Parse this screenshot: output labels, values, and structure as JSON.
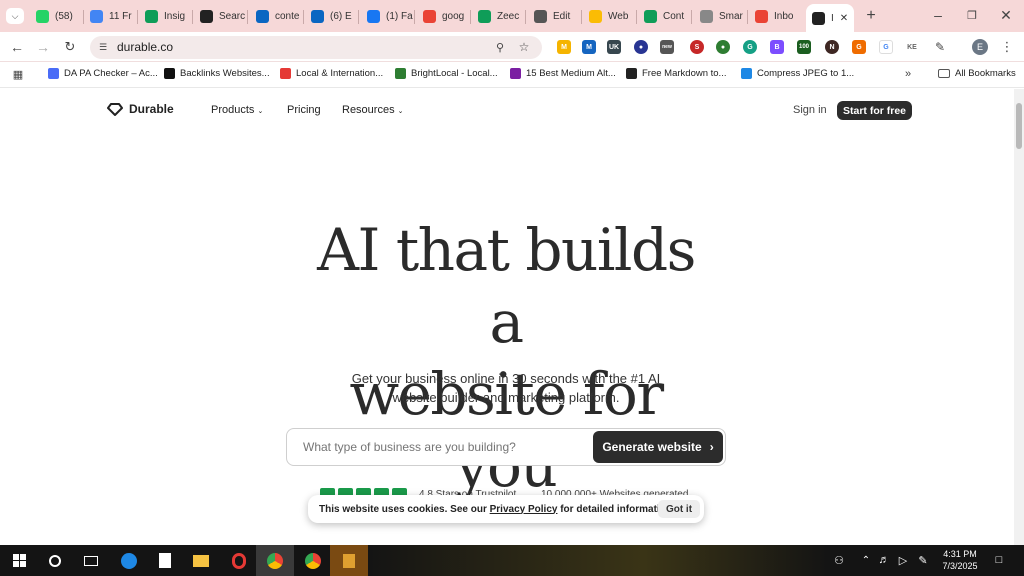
{
  "browser": {
    "tabs": [
      {
        "label": "(58)",
        "icon": "whatsapp-icon",
        "color": "#25d366"
      },
      {
        "label": "11 Fr",
        "icon": "docs-icon",
        "color": "#4285f4"
      },
      {
        "label": "Insig",
        "icon": "sheets-icon",
        "color": "#0f9d58"
      },
      {
        "label": "Searc",
        "icon": "ai-icon",
        "color": "#222222"
      },
      {
        "label": "conte",
        "icon": "linkedin-icon",
        "color": "#0a66c2"
      },
      {
        "label": "(6) E",
        "icon": "linkedin-icon",
        "color": "#0a66c2"
      },
      {
        "label": "(1) Fa",
        "icon": "facebook-icon",
        "color": "#1877f2"
      },
      {
        "label": "goog",
        "icon": "google-icon",
        "color": "#ea4335"
      },
      {
        "label": "Zeec",
        "icon": "sheets-icon",
        "color": "#0f9d58"
      },
      {
        "label": "Edit",
        "icon": "globe-icon",
        "color": "#555555"
      },
      {
        "label": "Web",
        "icon": "drive-icon",
        "color": "#fbbc04"
      },
      {
        "label": "Cont",
        "icon": "sheets-icon",
        "color": "#0f9d58"
      },
      {
        "label": "Smar",
        "icon": "dash-icon",
        "color": "#888888"
      },
      {
        "label": "Inbo",
        "icon": "gmail-icon",
        "color": "#ea4335"
      },
      {
        "label": "I",
        "icon": "durable-icon",
        "color": "#222222",
        "active": true
      }
    ],
    "url": "durable.co",
    "bookmarks": [
      {
        "label": "DA PA Checker – Ac...",
        "icon": "link-icon",
        "color": "#4a6cf7"
      },
      {
        "label": "Backlinks Websites...",
        "icon": "backlinks-icon",
        "color": "#111111"
      },
      {
        "label": "Local & Internation...",
        "icon": "pin-icon",
        "color": "#e53935"
      },
      {
        "label": "BrightLocal - Local...",
        "icon": "brightlocal-icon",
        "color": "#2e7d32"
      },
      {
        "label": "15 Best Medium Alt...",
        "icon": "medium-icon",
        "color": "#7b1fa2"
      },
      {
        "label": "Free Markdown to...",
        "icon": "markdown-icon",
        "color": "#222222"
      },
      {
        "label": "Compress JPEG to 1...",
        "icon": "file-icon",
        "color": "#1e88e5"
      }
    ],
    "all_bookmarks": "All Bookmarks",
    "profile_initial": "E"
  },
  "site": {
    "brand": "Durable",
    "nav": {
      "products": "Products",
      "pricing": "Pricing",
      "resources": "Resources"
    },
    "sign_in": "Sign in",
    "start_free": "Start for free",
    "hero_line1": "AI that builds a",
    "hero_line2": "website for you",
    "sub_line1": "Get your business online in 30 seconds with the #1 AI",
    "sub_line2": "website builder and marketing platform.",
    "search_placeholder": "What type of business are you building?",
    "generate": "Generate website",
    "rating_text": "4.8 Stars on Trustpilot",
    "websites_text": "10,000,000+ Websites generated"
  },
  "cookie": {
    "text_before": "This website uses cookies. See our ",
    "link": "Privacy Policy",
    "text_after": " for detailed information.",
    "button": "Got it"
  },
  "taskbar": {
    "time": "4:31 PM",
    "date": "7/3/2025"
  }
}
